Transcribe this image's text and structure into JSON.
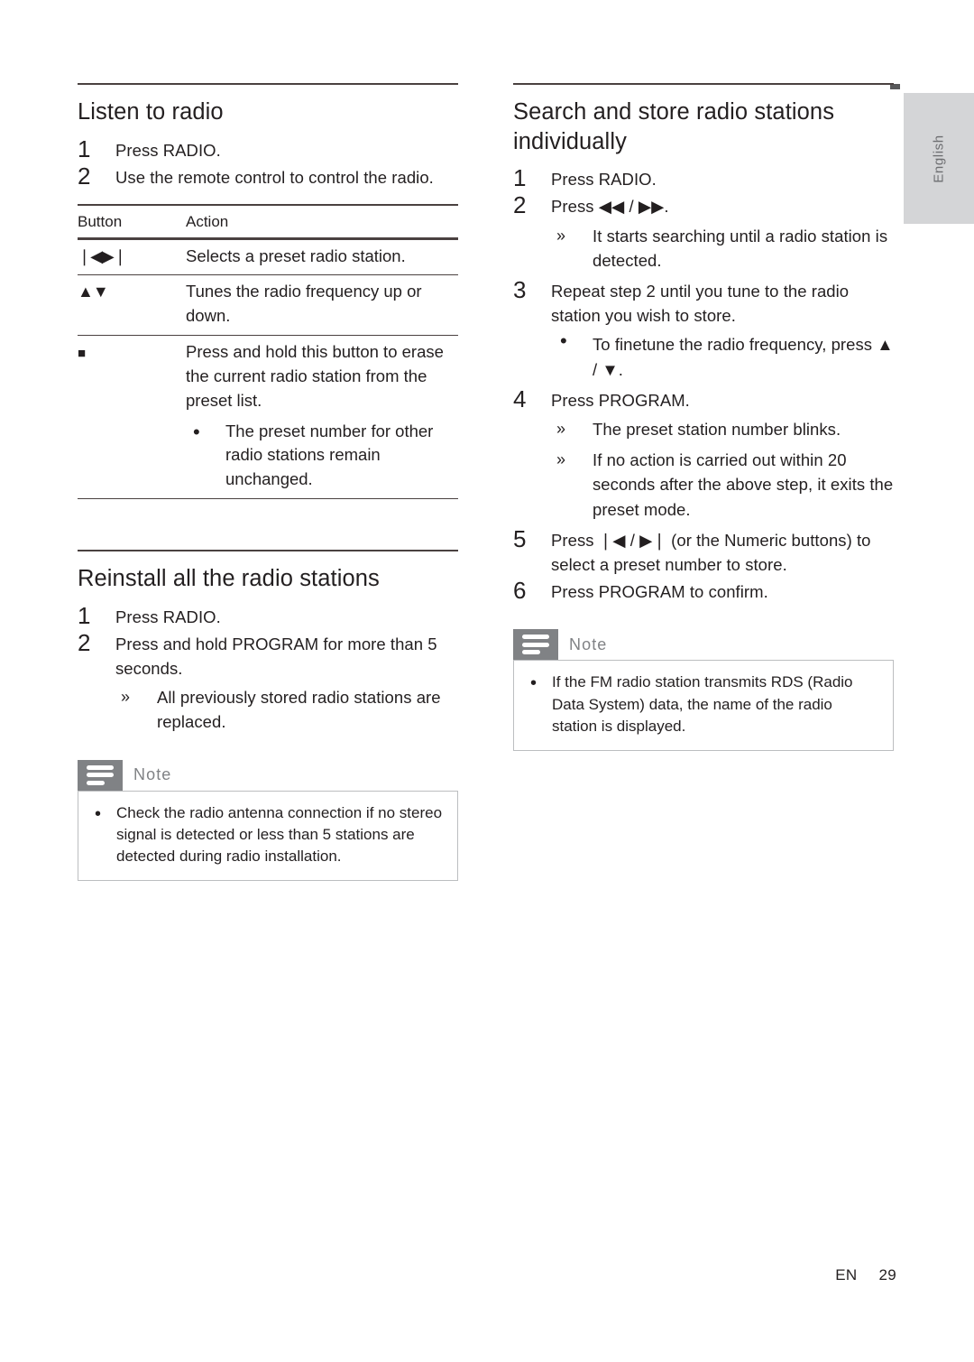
{
  "document": {
    "language_tab": "English",
    "footer": {
      "locale": "EN",
      "page_number": "29"
    }
  },
  "left_column": {
    "section1": {
      "title": "Listen to radio",
      "steps": [
        {
          "num": "1",
          "text": "Press RADIO."
        },
        {
          "num": "2",
          "text": "Use the remote control to control the radio."
        }
      ],
      "table": {
        "headers": [
          "Button",
          "Action"
        ],
        "rows": [
          {
            "button": "❘◀▶❘",
            "action": "Selects a preset radio station.",
            "subs": []
          },
          {
            "button": "▲▼",
            "action": "Tunes the radio frequency up or down.",
            "subs": []
          },
          {
            "button": "■",
            "action": "Press and hold this button to erase the current radio station from the preset list.",
            "subs": [
              {
                "marker": "•",
                "text": "The preset number for other radio stations remain unchanged."
              }
            ]
          }
        ]
      }
    },
    "section2": {
      "title": "Reinstall all the radio stations",
      "steps": [
        {
          "num": "1",
          "text": "Press RADIO.",
          "subs": []
        },
        {
          "num": "2",
          "text": "Press and hold PROGRAM for more than 5 seconds.",
          "subs": [
            {
              "marker": "»",
              "text": "All previously stored radio stations are replaced."
            }
          ]
        }
      ],
      "note": {
        "title": "Note",
        "items": [
          "Check the radio antenna connection if no stereo signal is detected or less than 5 stations are detected during radio installation."
        ]
      }
    }
  },
  "right_column": {
    "section1": {
      "title": "Search and store radio stations individually",
      "steps": [
        {
          "num": "1",
          "text": "Press RADIO.",
          "subs": []
        },
        {
          "num": "2",
          "text": "Press ◀◀ / ▶▶.",
          "subs": [
            {
              "marker": "»",
              "text": "It starts searching until a radio station is detected."
            }
          ]
        },
        {
          "num": "3",
          "text": "Repeat step 2 until you tune to the radio station you wish to store.",
          "subs": [
            {
              "marker": "•",
              "text": "To finetune the radio frequency, press ▲ / ▼."
            }
          ]
        },
        {
          "num": "4",
          "text": "Press PROGRAM.",
          "subs": [
            {
              "marker": "»",
              "text": "The preset station number blinks."
            },
            {
              "marker": "»",
              "text": "If no action is carried out within 20 seconds after the above step, it exits the preset mode."
            }
          ]
        },
        {
          "num": "5",
          "text": "Press ❘◀ / ▶❘ (or the Numeric buttons) to select a preset number to store.",
          "subs": []
        },
        {
          "num": "6",
          "text": "Press PROGRAM to confirm.",
          "subs": []
        }
      ],
      "note": {
        "title": "Note",
        "items": [
          "If the FM radio station transmits RDS (Radio Data System) data, the name of the radio station is displayed."
        ]
      }
    }
  },
  "colors": {
    "rule": "#4a4140",
    "note_tab": "#808285",
    "note_border": "#bcbec0",
    "lang_tab": "#d4d5d7",
    "text": "#231f20"
  }
}
